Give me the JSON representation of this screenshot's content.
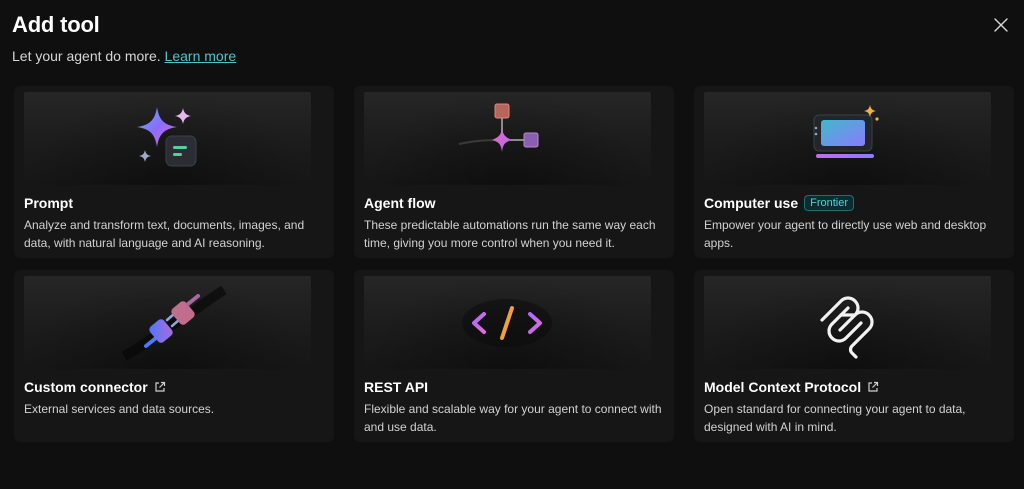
{
  "dialog": {
    "title": "Add tool",
    "subtitle": "Let your agent do more.",
    "learn_more": "Learn more"
  },
  "cards": [
    {
      "title": "Prompt",
      "description": "Analyze and transform text, documents, images, and data, with natural language and AI reasoning.",
      "icon": "prompt-sparkle-icon"
    },
    {
      "title": "Agent flow",
      "description": "These predictable automations run the same way each time, giving you more control when you need it.",
      "icon": "agent-flow-icon"
    },
    {
      "title": "Computer use",
      "badge": "Frontier",
      "description": "Empower your agent to directly use web and desktop apps.",
      "icon": "computer-use-icon"
    },
    {
      "title": "Custom connector",
      "description": "External services and data sources.",
      "icon": "plug-connector-icon",
      "external": true
    },
    {
      "title": "REST API",
      "description": "Flexible and scalable way for your agent to connect with and use data.",
      "icon": "code-brackets-icon"
    },
    {
      "title": "Model Context Protocol",
      "description": "Open standard for connecting your agent to data, designed with AI in mind.",
      "icon": "mcp-logo-icon",
      "external": true
    }
  ],
  "colors": {
    "background": "#0f0f0f",
    "card": "#161616",
    "link": "#4fc3c9",
    "badge_text": "#4fd1d9"
  }
}
